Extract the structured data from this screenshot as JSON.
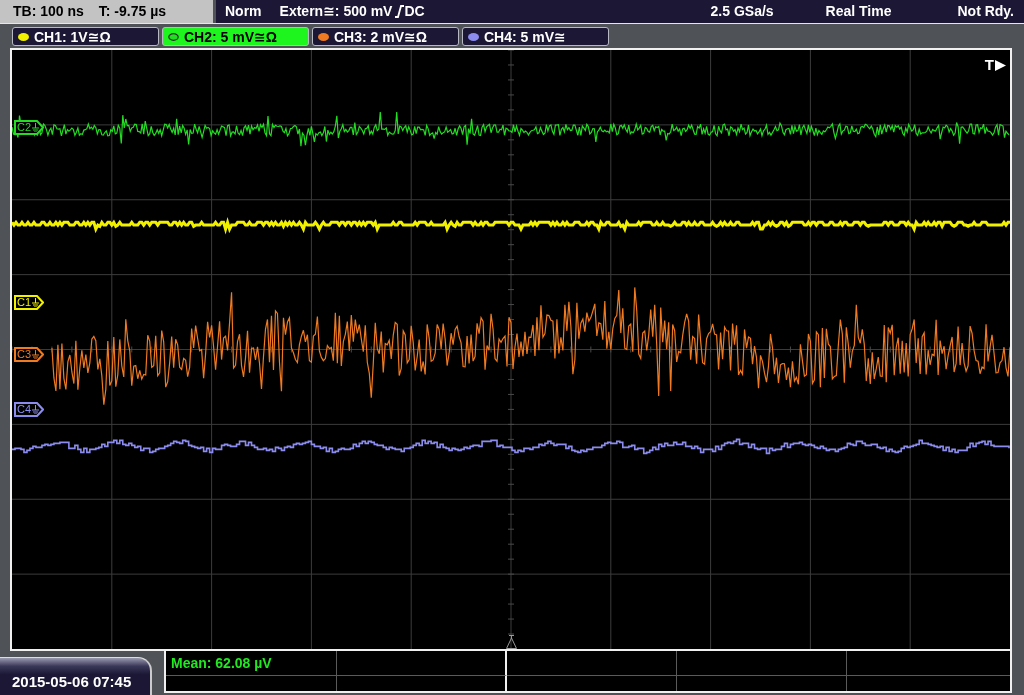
{
  "status_bar": {
    "timebase": "TB: 100 ns",
    "trigger_time": "T: -9.75 µs",
    "trigger_mode": "Norm",
    "trigger_source": "Extern≅: 500 mV",
    "trigger_coupling": "DC",
    "sample_rate": "2.5 GSa/s",
    "acquisition": "Real Time",
    "state": "Not Rdy."
  },
  "channels": [
    {
      "label": "CH1: 1V≅Ω",
      "color": "#f0f000",
      "selected": false
    },
    {
      "label": "CH2: 5 mV≅Ω",
      "color": "#22dd22",
      "selected": true
    },
    {
      "label": "CH3: 2 mV≅Ω",
      "color": "#f07a22",
      "selected": false
    },
    {
      "label": "CH4: 5 mV≅",
      "color": "#8c8cf0",
      "selected": false
    }
  ],
  "screen": {
    "trigger_label": "T",
    "markers": [
      {
        "label": "C2",
        "color": "#22dd22"
      },
      {
        "label": "C1",
        "color": "#f0f000"
      },
      {
        "label": "C3",
        "color": "#f07a22"
      },
      {
        "label": "C4",
        "color": "#8c8cf0"
      }
    ]
  },
  "footer": {
    "date_time": "2015-05-06 07:45",
    "measurements": [
      {
        "text": "Mean: 62.08 µV"
      }
    ]
  }
}
